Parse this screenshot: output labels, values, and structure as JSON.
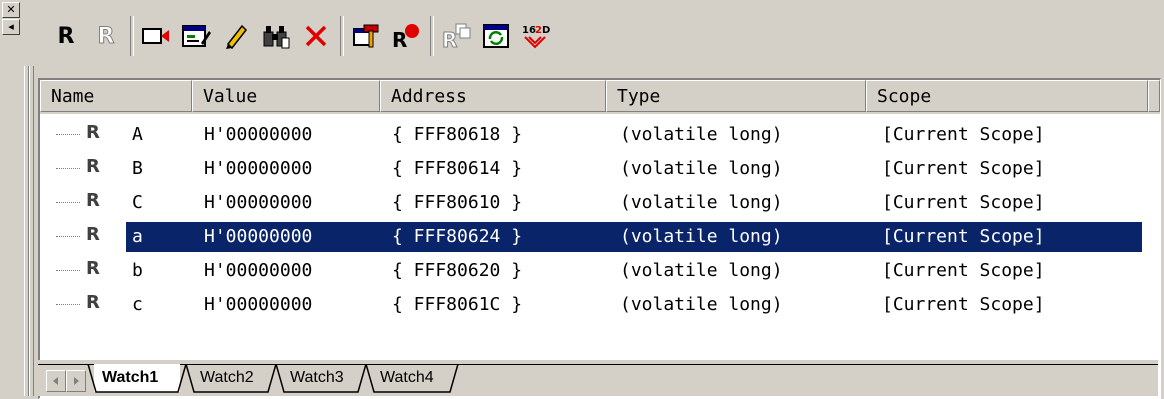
{
  "toolbar": {
    "icons": [
      "register-r-icon",
      "register-r-disabled-icon",
      "video-icon",
      "edit-window-icon",
      "pencil-icon",
      "binoculars-icon",
      "delete-x-icon",
      "hammer-icon",
      "register-record-icon",
      "register-copy-icon",
      "refresh-icon",
      "radix-icon"
    ],
    "radix_label": "16 2D"
  },
  "columns": [
    "Name",
    "Value",
    "Address",
    "Type",
    "Scope"
  ],
  "rows": [
    {
      "name": "A",
      "value": "H'00000000",
      "address": "{ FFF80618 }",
      "type": "(volatile long)",
      "scope": "[Current Scope]",
      "selected": false
    },
    {
      "name": "B",
      "value": "H'00000000",
      "address": "{ FFF80614 }",
      "type": "(volatile long)",
      "scope": "[Current Scope]",
      "selected": false
    },
    {
      "name": "C",
      "value": "H'00000000",
      "address": "{ FFF80610 }",
      "type": "(volatile long)",
      "scope": "[Current Scope]",
      "selected": false
    },
    {
      "name": "a",
      "value": "H'00000000",
      "address": "{ FFF80624 }",
      "type": "(volatile long)",
      "scope": "[Current Scope]",
      "selected": true
    },
    {
      "name": "b",
      "value": "H'00000000",
      "address": "{ FFF80620 }",
      "type": "(volatile long)",
      "scope": "[Current Scope]",
      "selected": false
    },
    {
      "name": "c",
      "value": "H'00000000",
      "address": "{ FFF8061C }",
      "type": "(volatile long)",
      "scope": "[Current Scope]",
      "selected": false
    }
  ],
  "tabs": [
    "Watch1",
    "Watch2",
    "Watch3",
    "Watch4"
  ],
  "active_tab": "Watch1",
  "colors": {
    "selection": "#0a246a",
    "face": "#d4d0c8",
    "accent_red": "#e00000"
  }
}
